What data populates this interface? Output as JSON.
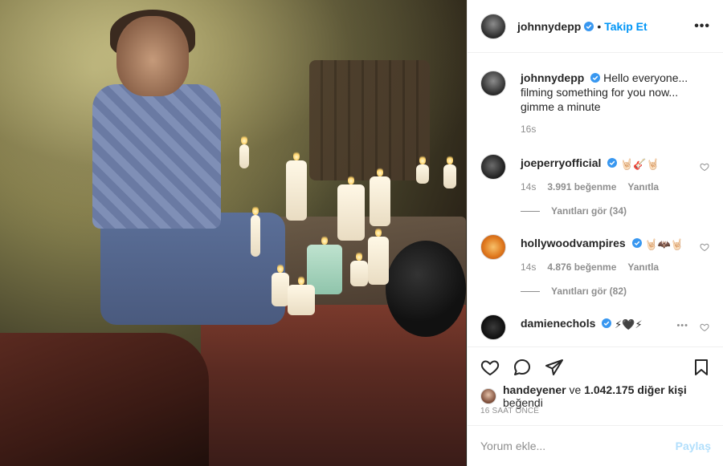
{
  "post": {
    "username": "johnnydepp",
    "follow_label": "Takip Et",
    "more_label": "•••"
  },
  "caption": {
    "username": "johnnydepp",
    "text": "Hello everyone... filming something for you now... gimme a minute",
    "time": "16s"
  },
  "comments": [
    {
      "username": "joeperryofficial",
      "emojis": "🤘🏻🎸🤘🏻",
      "time": "14s",
      "likes": "3.991 beğenme",
      "reply_label": "Yanıtla",
      "view_replies": "Yanıtları gör (34)"
    },
    {
      "username": "hollywoodvampires",
      "emojis": "🤘🏻🦇🤘🏻",
      "time": "14s",
      "likes": "4.876 beğenme",
      "reply_label": "Yanıtla",
      "view_replies": "Yanıtları gör (82)"
    },
    {
      "username": "damienechols",
      "emojis": "⚡🖤⚡",
      "more_label": "•••"
    }
  ],
  "liked_by": {
    "user": "handeyener",
    "connector": "ve",
    "others": "1.042.175 diğer kişi",
    "suffix": "beğendi"
  },
  "timestamp": "16 SAAT ÖNCE",
  "composer": {
    "placeholder": "Yorum ekle...",
    "post_label": "Paylaş"
  },
  "colors": {
    "accent": "#0095f6",
    "verified": "#3897f0",
    "muted": "#8e8e8e",
    "post_disabled": "#b2dffc"
  }
}
